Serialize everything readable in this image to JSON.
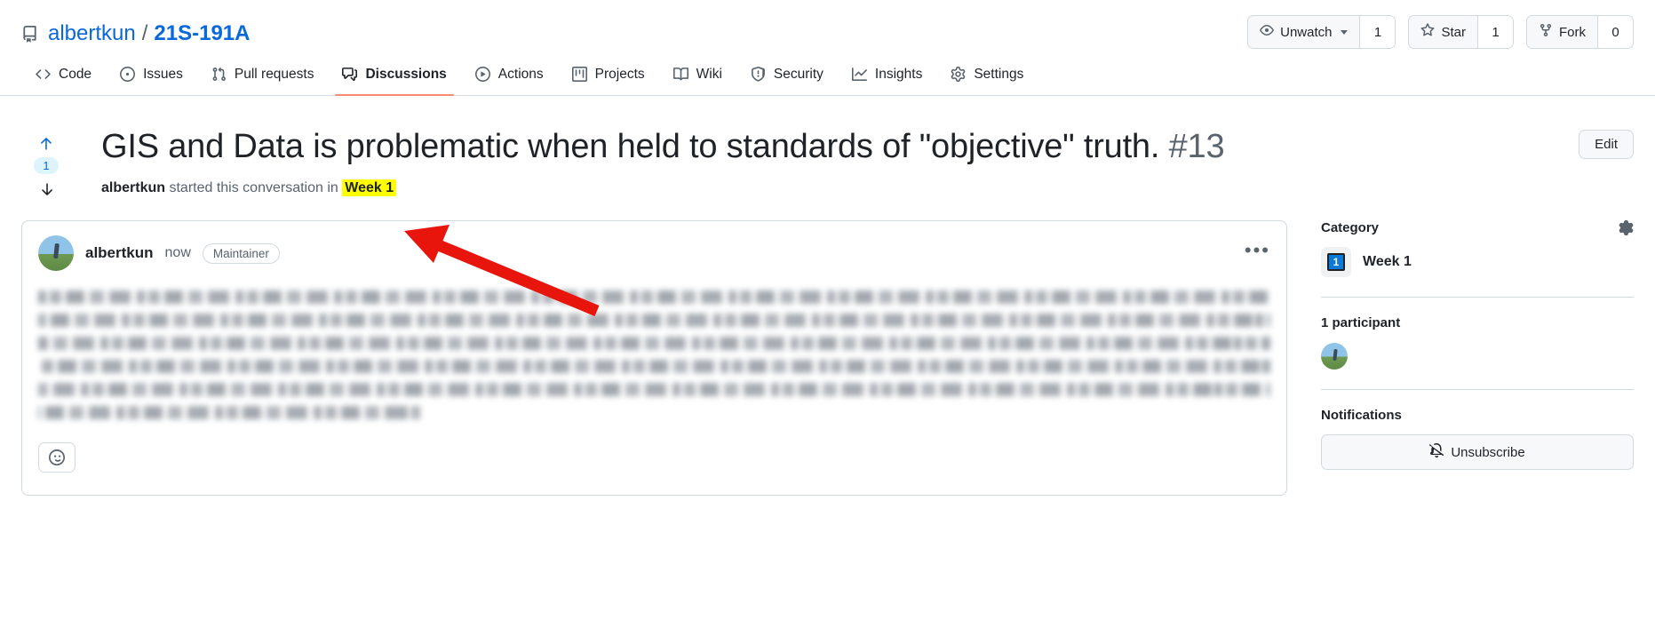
{
  "repo": {
    "icon": "repo-book-icon",
    "owner": "albertkun",
    "separator": "/",
    "name": "21S-191A"
  },
  "repo_actions": {
    "watch": {
      "label": "Unwatch",
      "count": "1",
      "icon": "eye-icon"
    },
    "star": {
      "label": "Star",
      "count": "1",
      "icon": "star-icon"
    },
    "fork": {
      "label": "Fork",
      "count": "0",
      "icon": "fork-icon"
    }
  },
  "nav_tabs": [
    {
      "label": "Code",
      "icon": "code-icon",
      "active": false
    },
    {
      "label": "Issues",
      "icon": "issue-opened-icon",
      "active": false
    },
    {
      "label": "Pull requests",
      "icon": "git-pull-request-icon",
      "active": false
    },
    {
      "label": "Discussions",
      "icon": "comment-discussion-icon",
      "active": true
    },
    {
      "label": "Actions",
      "icon": "play-icon",
      "active": false
    },
    {
      "label": "Projects",
      "icon": "project-icon",
      "active": false
    },
    {
      "label": "Wiki",
      "icon": "book-icon",
      "active": false
    },
    {
      "label": "Security",
      "icon": "shield-icon",
      "active": false
    },
    {
      "label": "Insights",
      "icon": "graph-icon",
      "active": false
    },
    {
      "label": "Settings",
      "icon": "gear-icon",
      "active": false
    }
  ],
  "discussion": {
    "title": "GIS and Data is problematic when held to standards of \"objective\" truth.",
    "number": "#13",
    "edit_label": "Edit",
    "vote_count": "1",
    "byline": {
      "author": "albertkun",
      "text": "started this conversation in",
      "category": "Week 1"
    }
  },
  "comment": {
    "author": "albertkun",
    "time": "now",
    "role_badge": "Maintainer",
    "menu_icon": "kebab-horizontal-icon",
    "reaction_icon": "smiley-icon",
    "body_redacted": true
  },
  "sidebar": {
    "category": {
      "title": "Category",
      "gear_icon": "gear-icon",
      "emoji_label": "1",
      "name": "Week 1"
    },
    "participants": {
      "title": "1 participant"
    },
    "notifications": {
      "title": "Notifications",
      "button_label": "Unsubscribe",
      "button_icon": "bell-slash-icon"
    }
  },
  "annotation": {
    "arrow_color": "#e8150c",
    "points_to": "Week 1"
  },
  "colors": {
    "link": "#0969da",
    "accent_tab": "#fd8c73",
    "highlight": "#ffff00",
    "border": "#d1d9e0",
    "muted_text": "#59636e",
    "category_blue": "#0a7ada"
  }
}
